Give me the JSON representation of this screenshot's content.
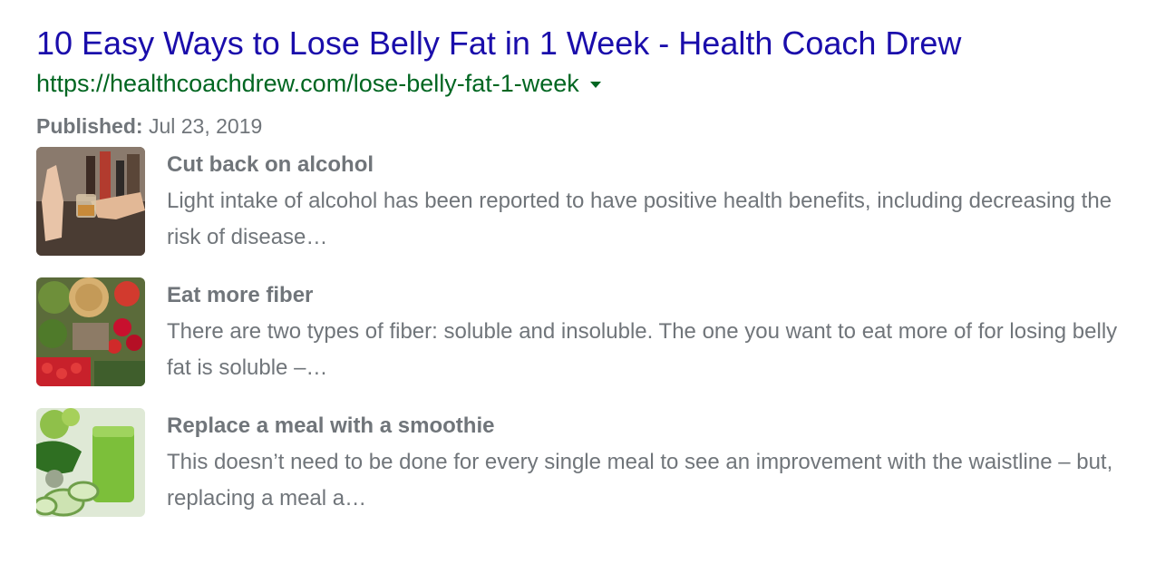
{
  "result": {
    "title": "10 Easy Ways to Lose Belly Fat in 1 Week - Health Coach Drew",
    "url": "https://healthcoachdrew.com/lose-belly-fat-1-week",
    "published_label": "Published:",
    "published_date": "Jul 23, 2019"
  },
  "items": [
    {
      "title": "Cut back on alcohol",
      "snippet": "Light intake of alcohol has been reported to have positive health benefits, including decreasing the risk of disease…",
      "image": "alcohol-refusal-photo"
    },
    {
      "title": "Eat more fiber",
      "snippet": "There are two types of fiber: soluble and insoluble. The one you want to eat more of for losing belly fat is soluble –…",
      "image": "fiber-foods-photo"
    },
    {
      "title": "Replace a meal with a smoothie",
      "snippet": "This doesn’t need to be done for every single meal to see an improvement with the waistline – but, replacing a meal a…",
      "image": "green-smoothie-photo"
    }
  ],
  "colors": {
    "title": "#1a0dab",
    "url": "#006621",
    "meta_text": "#70757a"
  }
}
